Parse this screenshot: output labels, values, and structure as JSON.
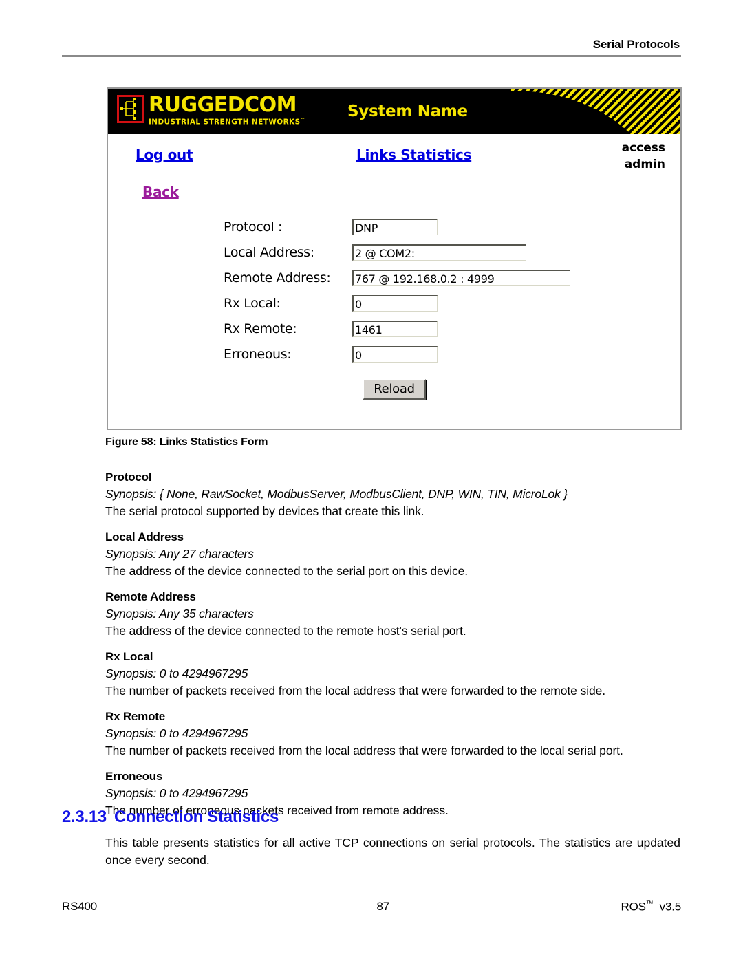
{
  "page_header": {
    "running_head": "Serial Protocols"
  },
  "screenshot": {
    "banner": {
      "logo_word": "RUGGEDCOM",
      "logo_tagline": "INDUSTRIAL STRENGTH NETWORKS",
      "logo_tagline_tm": "™",
      "system_name": "System Name"
    },
    "nav": {
      "logout_label": "Log out",
      "page_title": "Links Statistics",
      "access_label": "access",
      "access_user": "admin",
      "back_label": "Back"
    },
    "form": {
      "fields": [
        {
          "label": "Protocol :",
          "value": "DNP"
        },
        {
          "label": "Local Address:",
          "value": "2 @ COM2:"
        },
        {
          "label": "Remote Address:",
          "value": "767 @ 192.168.0.2 : 4999"
        },
        {
          "label": "Rx Local:",
          "value": "0"
        },
        {
          "label": "Rx Remote:",
          "value": "1461"
        },
        {
          "label": "Erroneous:",
          "value": "0"
        }
      ],
      "reload_label": "Reload"
    },
    "colors": {
      "banner_background": "#000000",
      "logo_yellow": "#f5e400",
      "logo_red": "#d10f12",
      "link_blue": "#0000e0",
      "visited_link_purple": "#9b1b9b",
      "button_face": "#d6d3ce"
    }
  },
  "figure": {
    "caption": "Figure 58: Links Statistics Form"
  },
  "definitions": [
    {
      "term": "Protocol",
      "synopsis": "Synopsis: { None, RawSocket, ModbusServer, ModbusClient, DNP, WIN, TIN, MicroLok }",
      "description": "The serial protocol supported by devices that create this link."
    },
    {
      "term": "Local Address",
      "synopsis": "Synopsis: Any 27 characters",
      "description": "The address of the device connected to the serial port on this device."
    },
    {
      "term": "Remote Address",
      "synopsis": "Synopsis: Any 35 characters",
      "description": "The address of the device connected to the remote host's serial port."
    },
    {
      "term": "Rx Local",
      "synopsis": "Synopsis: 0 to 4294967295",
      "description": "The number of packets received from the local address that were forwarded to the remote side."
    },
    {
      "term": "Rx Remote",
      "synopsis": "Synopsis: 0 to 4294967295",
      "description": "The number of packets received from the local address that were forwarded to the local serial port."
    },
    {
      "term": "Erroneous",
      "synopsis": "Synopsis: 0 to 4294967295",
      "description": "The number of erroneous packets received from remote address."
    }
  ],
  "section": {
    "number": "2.3.13",
    "title": "Connection Statistics",
    "body": "This table presents statistics for all active TCP connections on serial protocols. The statistics are updated once every second.",
    "heading_color": "#1414e6"
  },
  "footer": {
    "left": "RS400",
    "center": "87",
    "right_text": "ROS",
    "right_tm": "™",
    "right_version": "v3.5"
  }
}
